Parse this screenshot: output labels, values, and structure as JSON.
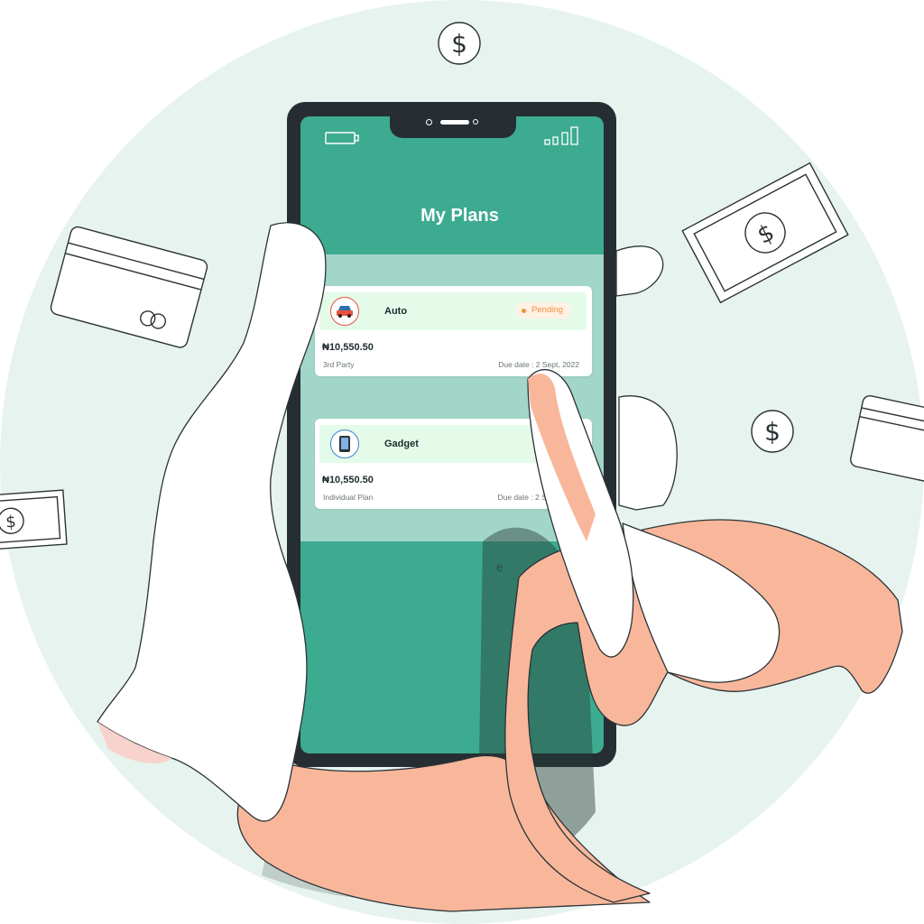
{
  "header": {
    "title": "My Plans"
  },
  "plans": [
    {
      "name": "Auto",
      "status": "Pending",
      "amount": "₦10,550.50",
      "type": "3rd Party",
      "due": "Due date : 2 Sept, 2022"
    },
    {
      "name": "Gadget",
      "status": "",
      "amount": "₦10,550.50",
      "type": "Individual Plan",
      "due": "Due date : 2 Sept,"
    }
  ],
  "icons": [
    "battery-icon",
    "signal-icon",
    "car-icon",
    "phone-icon",
    "dollar-coin-icon",
    "banknote-icon",
    "credit-card-icon"
  ],
  "colors": {
    "screen": "#3dab90",
    "content": "#a2d6c8",
    "card_header": "#e4fbe9",
    "pending": "#f2913d",
    "background": "#e6f3ef",
    "skin": "#f8b79b"
  },
  "stray_text": "e"
}
